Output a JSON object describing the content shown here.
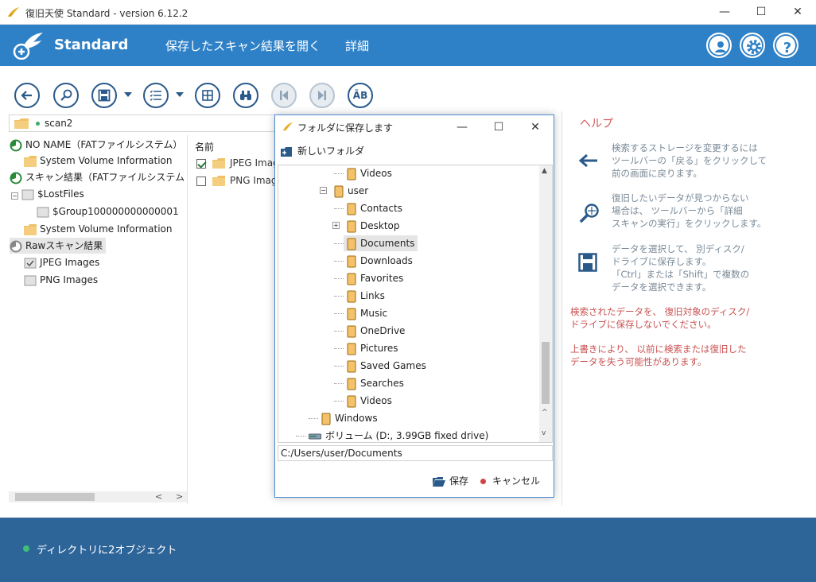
{
  "window": {
    "title": "復旧天使 Standard - version 6.12.2",
    "minimize": "—",
    "maximize": "☐",
    "close": "✕"
  },
  "header": {
    "brand": "Standard",
    "nav_open_results": "保存したスキャン結果を開く",
    "nav_details": "詳細",
    "accent": "#2f81c7"
  },
  "toolbar": {
    "case_button_label": "ĀB"
  },
  "path": {
    "value": "scan2"
  },
  "tree": {
    "items": [
      {
        "label": "NO NAME（FATファイルシステム）"
      },
      {
        "label": "System Volume Information"
      },
      {
        "label": "スキャン結果（FATファイルシステム"
      },
      {
        "label": "$LostFiles"
      },
      {
        "label": "$Group100000000000001"
      },
      {
        "label": "System Volume Information"
      },
      {
        "label": "Rawスキャン結果"
      },
      {
        "label": "JPEG Images"
      },
      {
        "label": "PNG Images"
      }
    ]
  },
  "filelist": {
    "header": "名前",
    "rows": [
      {
        "label": "JPEG Images",
        "checked": true
      },
      {
        "label": "PNG Images",
        "checked": false
      }
    ]
  },
  "dialog": {
    "title": "フォルダに保存します",
    "new_folder": "新しいフォルダ",
    "minimize": "—",
    "maximize": "☐",
    "close": "✕",
    "nodes": [
      {
        "label": "Videos"
      },
      {
        "label": "user"
      },
      {
        "label": "Contacts"
      },
      {
        "label": "Desktop"
      },
      {
        "label": "Documents"
      },
      {
        "label": "Downloads"
      },
      {
        "label": "Favorites"
      },
      {
        "label": "Links"
      },
      {
        "label": "Music"
      },
      {
        "label": "OneDrive"
      },
      {
        "label": "Pictures"
      },
      {
        "label": "Saved Games"
      },
      {
        "label": "Searches"
      },
      {
        "label": "Videos"
      },
      {
        "label": "Windows"
      },
      {
        "label": "ボリューム (D:, 3.99GB fixed drive)"
      }
    ],
    "path_value": "C:/Users/user/Documents",
    "save": "保存",
    "cancel": "キャンセル"
  },
  "help": {
    "title": "ヘルプ",
    "item1": [
      "検索するストレージを変更するには",
      "ツールバーの「戻る」をクリックして",
      "前の画面に戻ります。"
    ],
    "item2": [
      "復旧したいデータが見つからない",
      "場合は、 ツールバーから「詳細",
      "スキャンの実行」をクリックします。"
    ],
    "item3": [
      "データを選択して、 別ディスク/",
      "ドライブに保存します。",
      "「Ctrl」または「Shift」で複数の",
      "データを選択できます。"
    ],
    "warn1": [
      "検索されたデータを、 復旧対象のディスク/",
      "ドライブに保存しないでください。"
    ],
    "warn2": [
      "上書きにより、 以前に検索または復旧した",
      "データを失う可能性があります。"
    ]
  },
  "status": {
    "text": "ディレクトリに2オブジェクト"
  }
}
